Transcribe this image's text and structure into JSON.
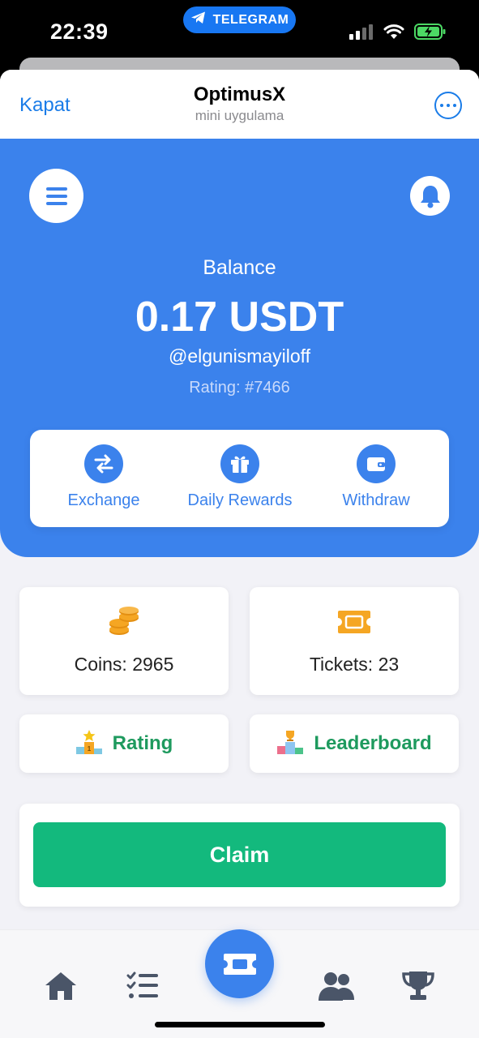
{
  "status_bar": {
    "time": "22:39",
    "pill_label": "TELEGRAM",
    "icons": [
      "signal-icon",
      "wifi-icon",
      "battery-charging-icon"
    ]
  },
  "header": {
    "close_label": "Kapat",
    "title": "OptimusX",
    "subtitle": "mini uygulama",
    "more_icon": "more-dots-icon"
  },
  "hero": {
    "menu_icon": "hamburger-menu-icon",
    "bell_icon": "bell-icon",
    "balance_label": "Balance",
    "balance_value": "0.17 USDT",
    "username": "@elgunismayiloff",
    "rating": "Rating: #7466"
  },
  "actions": [
    {
      "label": "Exchange",
      "icon": "exchange-arrows-icon"
    },
    {
      "label": "Daily Rewards",
      "icon": "gift-icon"
    },
    {
      "label": "Withdraw",
      "icon": "wallet-icon"
    }
  ],
  "stats": {
    "coins": "Coins: 2965",
    "tickets": "Tickets: 23"
  },
  "links": {
    "rating": "Rating",
    "leaderboard": "Leaderboard"
  },
  "claim": {
    "label": "Claim"
  },
  "tabbar": {
    "items": [
      "home-icon",
      "tasks-list-icon",
      "ticket-icon",
      "friends-icon",
      "trophy-icon"
    ]
  },
  "colors": {
    "primary_blue": "#3b82ec",
    "link_blue": "#1a7ce8",
    "claim_green": "#13b97d",
    "link_green": "#1e9a5e",
    "coin_orange": "#f5a623"
  }
}
